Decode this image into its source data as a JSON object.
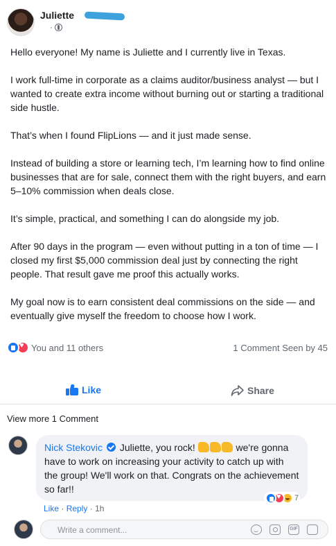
{
  "post": {
    "author": "Juliette",
    "meta_dot": "·",
    "paragraphs": [
      "Hello everyone! My name is Juliette and I currently live in Texas.",
      "I work full-time in corporate as a claims auditor/business analyst — but I wanted to create extra income without burning out or starting a traditional side hustle.",
      "That’s when I found FlipLions — and it just made sense.",
      "Instead of building a store or learning tech, I’m learning how to find online businesses that are for sale, connect them with the right buyers, and earn 5–10% commission when deals close.",
      "It’s simple, practical, and something I can do alongside my job.",
      "After 90 days in the program — even without putting in a ton of time — I closed my first $5,000 commission deal just by connecting the right people. That result gave me proof this actually works.",
      "My goal now is to earn consistent deal commissions on the side — and eventually give myself the freedom to choose how I work."
    ]
  },
  "reactions": {
    "summary": "You and 11 others",
    "counts": "1 Comment Seen by 45"
  },
  "actions": {
    "like_label": "Like",
    "share_label": "Share"
  },
  "comments": {
    "view_more": "View more 1 Comment",
    "items": [
      {
        "name": "Nick Stekovic",
        "text_a": "Juliette, you rock!",
        "text_b": "we're gonna have to work on increasing your activity to catch up with the group! We'll work on that. Congrats on the achievement so far!!",
        "reaction_count": "7",
        "like_link": "Like",
        "reply_link": "Reply",
        "sep": "·",
        "time": "1h"
      }
    ]
  },
  "composer": {
    "placeholder": "Write a comment..."
  },
  "colors": {
    "accent": "#1877f2",
    "love": "#f33e58",
    "muted": "#606770",
    "bubble": "#f0f2f5"
  },
  "icons": [
    "globe-icon",
    "like-reaction-icon",
    "love-reaction-icon",
    "haha-reaction-icon",
    "thumbs-up-icon",
    "share-icon",
    "verified-badge-icon",
    "flexed-biceps-emoji",
    "emoji-icon",
    "camera-icon",
    "gif-icon",
    "sticker-icon"
  ]
}
